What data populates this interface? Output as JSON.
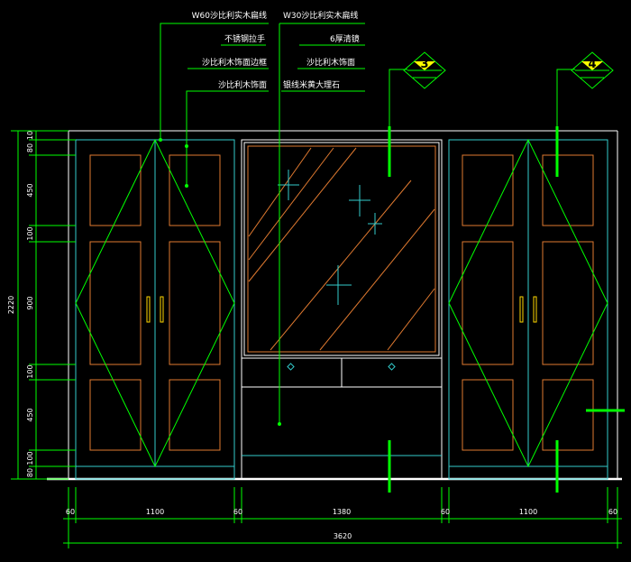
{
  "colors": {
    "background": "#000000",
    "frame": "#ffffff",
    "cabinet": "#33cccc",
    "panel": "#e07a30",
    "leader": "#00ff00",
    "dimension": "#00ff00",
    "tag_fill": "#ffff00",
    "handle": "#ffd700"
  },
  "annotations": {
    "left": [
      "W60沙比利实木扁线",
      "不锈钢拉手",
      "沙比利木饰面边框",
      "沙比利木饰面"
    ],
    "right": [
      "W30沙比利实木扁线",
      "6厚清镜",
      "沙比利木饰面",
      "银线米黄大理石"
    ]
  },
  "section_tags": [
    "3",
    "4"
  ],
  "dimensions": {
    "bottom": [
      "60",
      "1100",
      "60",
      "1380",
      "60",
      "1100",
      "60"
    ],
    "total_width": "3620",
    "left_vertical": [
      "10",
      "80",
      "450",
      "100",
      "900",
      "100",
      "450",
      "100",
      "80"
    ],
    "total_height": "2220"
  }
}
